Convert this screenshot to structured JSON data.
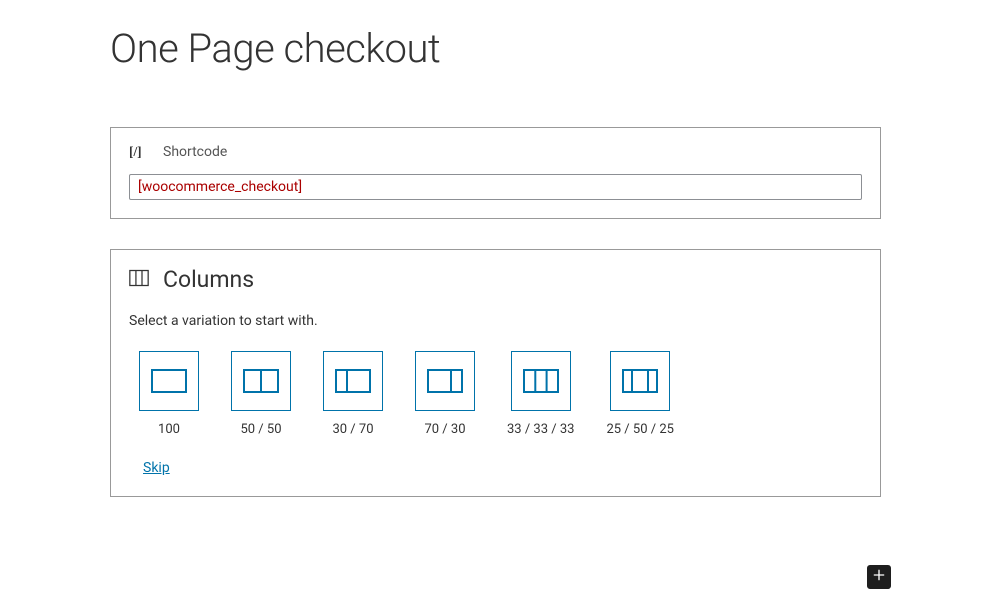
{
  "page": {
    "title": "One Page checkout"
  },
  "shortcode_block": {
    "label": "Shortcode",
    "value": "[woocommerce_checkout]"
  },
  "columns_block": {
    "title": "Columns",
    "description": "Select a variation to start with.",
    "variations": [
      {
        "label": "100"
      },
      {
        "label": "50 / 50"
      },
      {
        "label": "30 / 70"
      },
      {
        "label": "70 / 30"
      },
      {
        "label": "33 / 33 / 33"
      },
      {
        "label": "25 / 50 / 25"
      }
    ],
    "skip_label": "Skip"
  }
}
